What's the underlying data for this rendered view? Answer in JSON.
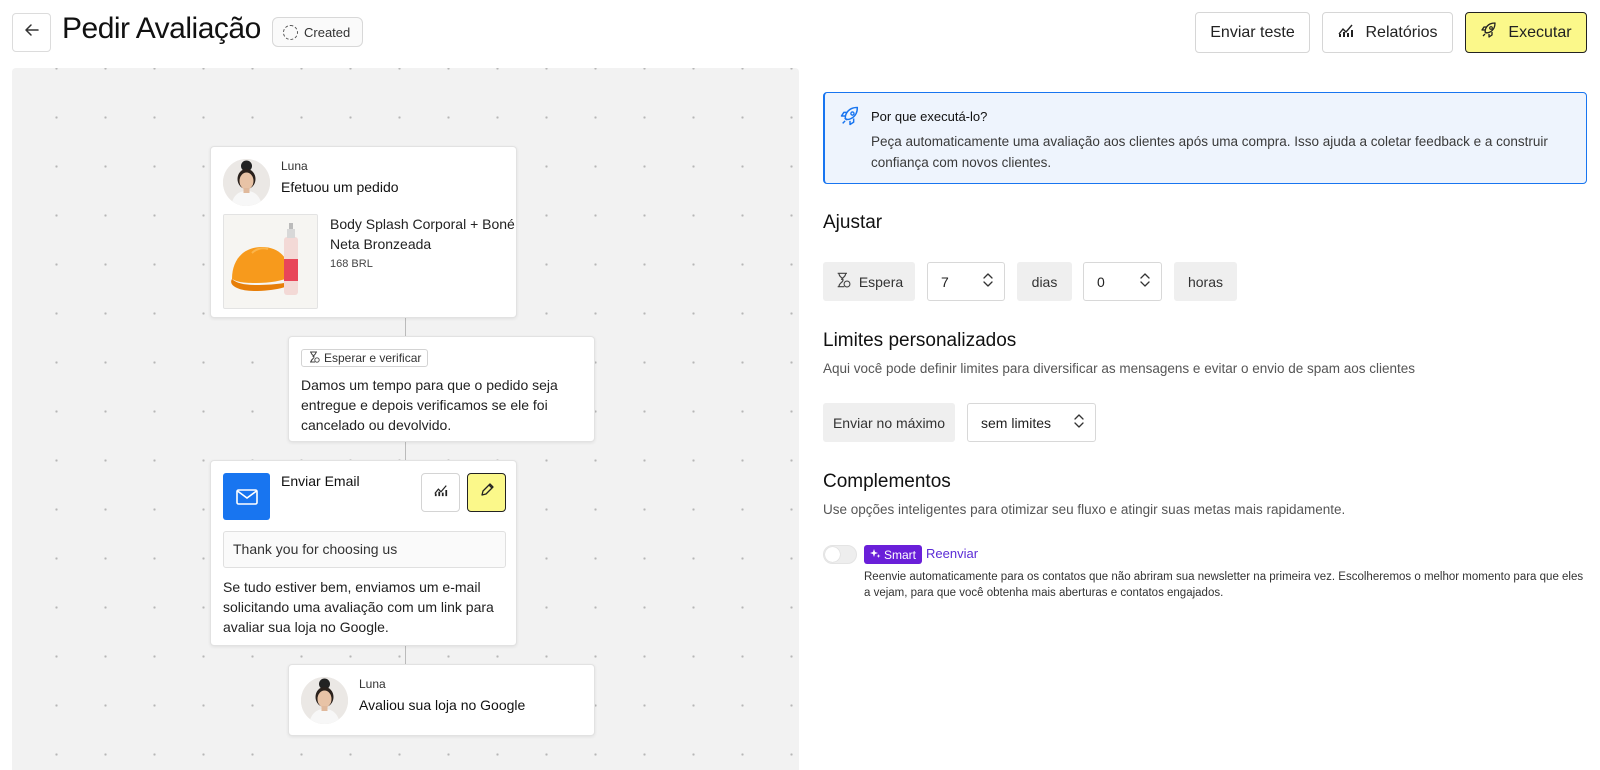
{
  "header": {
    "title": "Pedir Avaliação",
    "status": "Created",
    "send_test_label": "Enviar teste",
    "reports_label": "Relatórios",
    "run_label": "Executar"
  },
  "flow": {
    "order_card": {
      "contact_name": "Luna",
      "event": "Efetuou um pedido",
      "product_name": "Body Splash Corporal + Boné Neta Bronzeada",
      "product_price": "168 BRL"
    },
    "wait_card": {
      "chip": "Esperar e verificar",
      "text": "Damos um tempo para que o pedido seja entregue e depois verificamos se ele foi cancelado ou devolvido."
    },
    "email_card": {
      "title": "Enviar Email",
      "subject": "Thank you for choosing us",
      "text": "Se tudo estiver bem, enviamos um e-mail solicitando uma avaliação com um link para avaliar sua loja no Google."
    },
    "review_card": {
      "contact_name": "Luna",
      "event": "Avaliou sua loja no Google"
    }
  },
  "panel": {
    "info": {
      "title": "Por que executá-lo?",
      "text": "Peça automaticamente uma avaliação aos clientes após uma compra. Isso ajuda a coletar feedback e a construir confiança com novos clientes."
    },
    "adjust": {
      "title": "Ajustar",
      "wait_label": "Espera",
      "days_value": "7",
      "days_label": "dias",
      "hours_value": "0",
      "hours_label": "horas"
    },
    "limits": {
      "title": "Limites personalizados",
      "description": "Aqui você pode definir limites para diversificar as mensagens e evitar o envio de spam aos clientes",
      "max_label": "Enviar no máximo",
      "max_value": "sem limites"
    },
    "addons": {
      "title": "Complementos",
      "description": "Use opções inteligentes para otimizar seu fluxo e atingir suas metas mais rapidamente.",
      "smart_badge": "Smart",
      "resend_label": "Reenviar",
      "resend_enabled": false,
      "resend_description": "Reenvie automaticamente para os contatos que não abriram sua newsletter na primeira vez. Escolheremos o melhor momento para que eles a vejam, para que você obtenha mais aberturas e contatos engajados."
    }
  },
  "icons": {
    "back": "arrow-left-icon",
    "status": "dashed-circle-icon",
    "reports": "bar-chart-icon",
    "run": "rocket-icon",
    "wait": "hourglass-icon",
    "email": "envelope-icon",
    "edit": "pencil-icon",
    "stepper": "chevron-up-down-icon",
    "smart": "sparkle-icon"
  },
  "colors": {
    "accent_yellow": "#fbf88a",
    "email_blue": "#1875f0",
    "info_bg": "#eef4fd",
    "smart_purple": "#6a1fd9",
    "resend_purple": "#5b2bd6"
  }
}
